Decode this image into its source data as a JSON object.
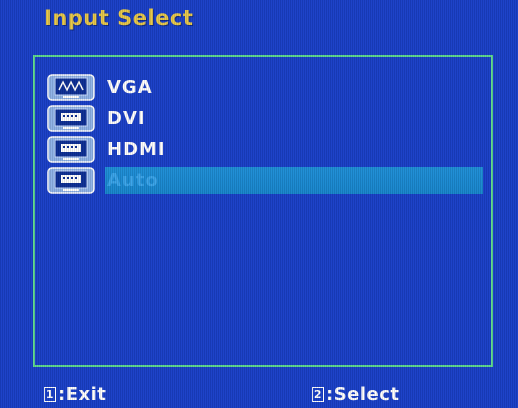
{
  "header": {
    "title": "Input Select"
  },
  "inputs": [
    {
      "label": "VGA",
      "icon": "vga-monitor-icon",
      "selected": false
    },
    {
      "label": "DVI",
      "icon": "dvi-monitor-icon",
      "selected": false
    },
    {
      "label": "HDMI",
      "icon": "hdmi-monitor-icon",
      "selected": false
    },
    {
      "label": "Auto",
      "icon": "auto-monitor-icon",
      "selected": true
    }
  ],
  "footer": {
    "exit_key": "1",
    "exit_label": ":Exit",
    "select_key": "2",
    "select_label": ":Select"
  },
  "colors": {
    "background": "#1a3fc8",
    "title": "#e8c84a",
    "panel_border": "#5fd88f",
    "selection": "#1788cf",
    "selected_text": "#3aa4ea",
    "text": "#ffffff"
  }
}
